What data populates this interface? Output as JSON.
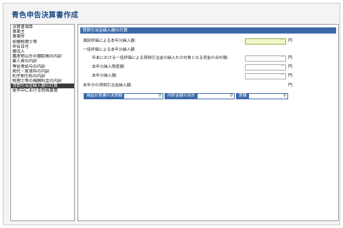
{
  "app": {
    "title": "青色申告決算書作成"
  },
  "sidebar": {
    "items": [
      {
        "label": "決算書項目",
        "selected": false
      },
      {
        "label": "事業主",
        "selected": false
      },
      {
        "label": "事業所",
        "selected": false
      },
      {
        "label": "依頼税理士等",
        "selected": false
      },
      {
        "label": "申告日付",
        "selected": false
      },
      {
        "label": "雑収入",
        "selected": false
      },
      {
        "label": "農産物以外の棚卸高の内訳",
        "selected": false
      },
      {
        "label": "雇人費の内訳",
        "selected": false
      },
      {
        "label": "専従者給与の内訳",
        "selected": false
      },
      {
        "label": "地代・家賃料の内訳",
        "selected": false
      },
      {
        "label": "利子割引料の内訳",
        "selected": false
      },
      {
        "label": "税理士等の報酬料金の内訳",
        "selected": false
      },
      {
        "label": "貸倒引当金繰入額の計算",
        "selected": true
      },
      {
        "label": "本年中における特殊事情",
        "selected": false
      }
    ]
  },
  "main": {
    "section_title": "貸倒引当金繰入額の計算",
    "individual_label": "個別評価による本年分繰入額:",
    "individual_value": "",
    "bulk_heading": "一括評価による本年分繰入額",
    "bulk_rows": [
      {
        "label": "年末における一括評価による貸倒引当金の繰入れの対象となる貸金の合計額:",
        "value": ""
      },
      {
        "label": "本年分繰入限度額:",
        "value": ""
      },
      {
        "label": "本年分繰入額:",
        "value": ""
      }
    ],
    "total_label": "本年分の貸倒引当金繰入額:",
    "yen": "円",
    "dropdown_arrow": "﹀",
    "summary": [
      {
        "label": "損益計算書の決算額",
        "value": "0"
      },
      {
        "label": "内訳金額の合計",
        "value": "0"
      },
      {
        "label": "差額",
        "value": "0"
      }
    ]
  }
}
